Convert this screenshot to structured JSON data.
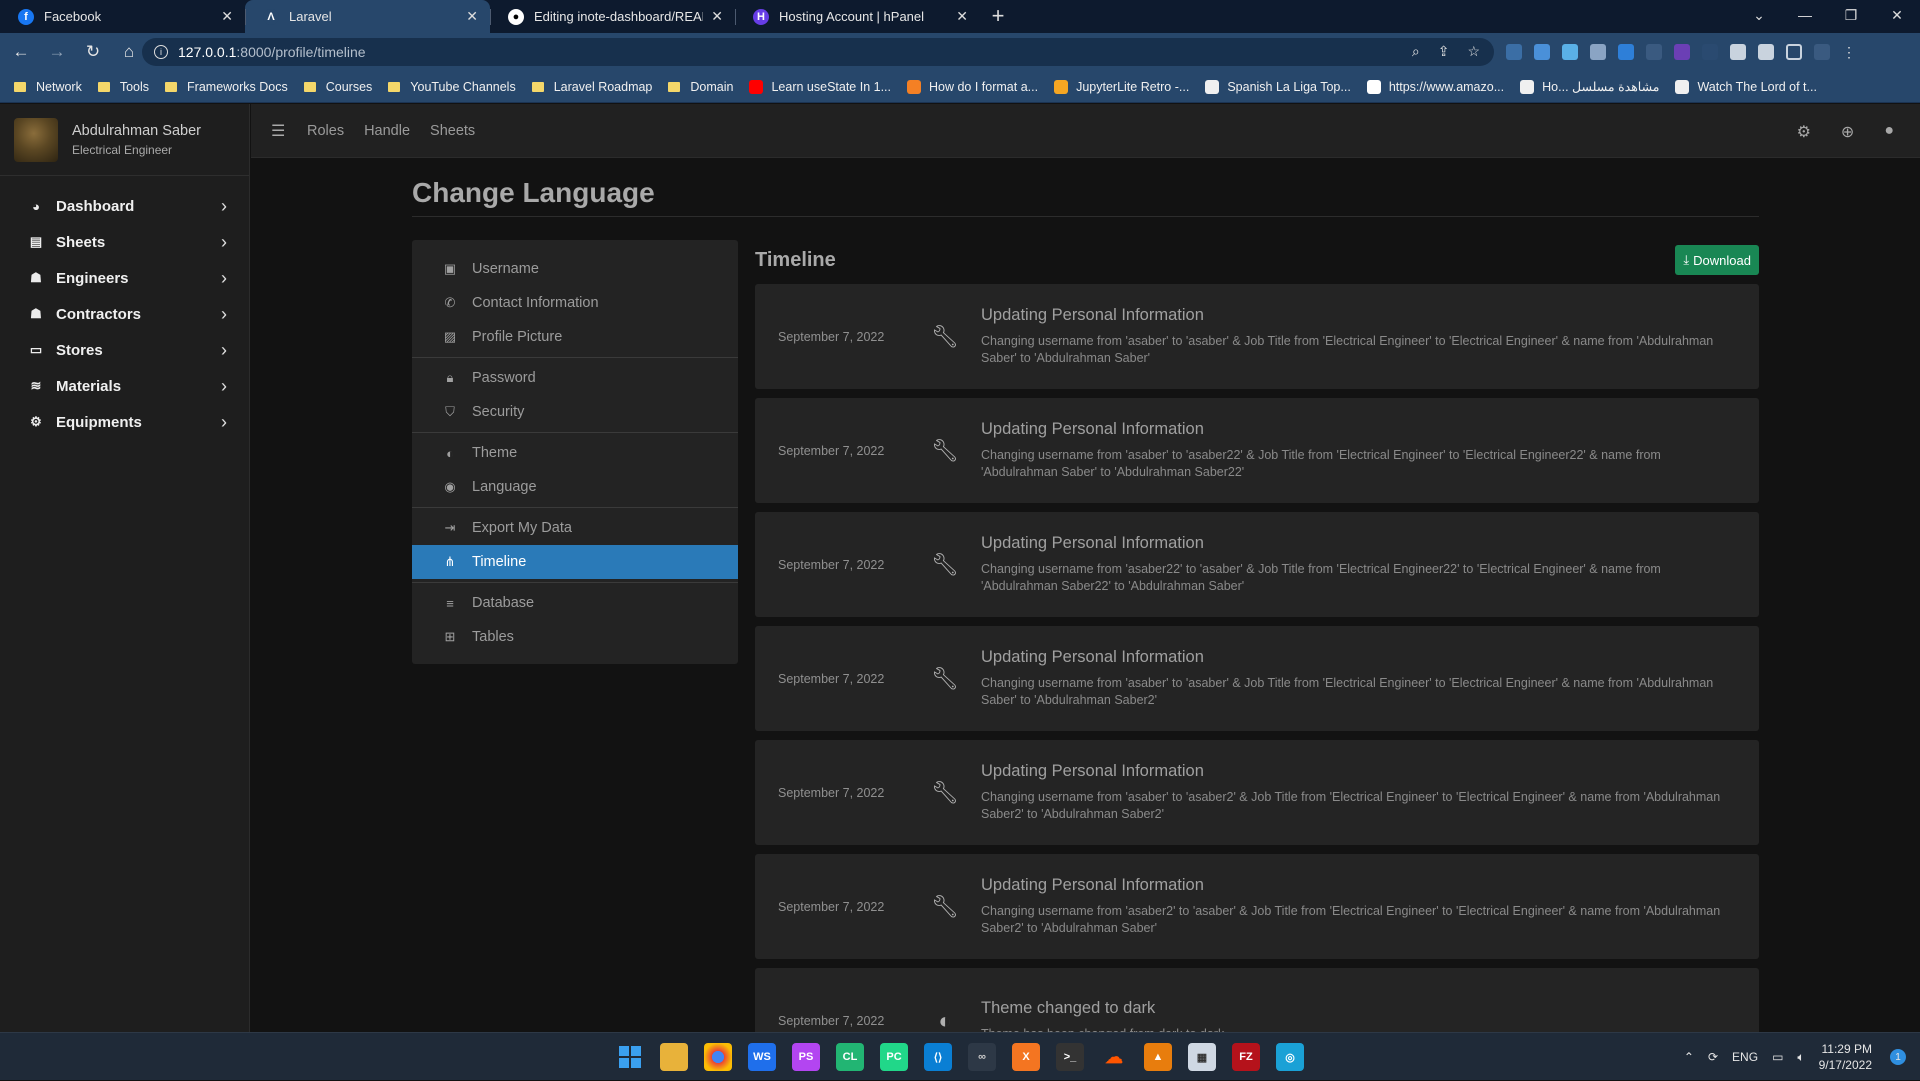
{
  "browser": {
    "tabs": [
      {
        "title": "Facebook",
        "favicon": "facebook-icon",
        "color": "#1877f2",
        "active": false
      },
      {
        "title": "Laravel",
        "favicon": "laravel-icon",
        "color": "#27476b",
        "active": true
      },
      {
        "title": "Editing inote-dashboard/README",
        "favicon": "github-icon",
        "color": "#ffffff",
        "active": false
      },
      {
        "title": "Hosting Account | hPanel",
        "favicon": "hostinger-icon",
        "color": "#673de6",
        "active": false
      }
    ],
    "url_host": "127.0.0.1",
    "url_path": ":8000/profile/timeline",
    "bookmarks": [
      {
        "label": "Network",
        "type": "folder"
      },
      {
        "label": "Tools",
        "type": "folder"
      },
      {
        "label": "Frameworks Docs",
        "type": "folder"
      },
      {
        "label": "Courses",
        "type": "folder"
      },
      {
        "label": "YouTube Channels",
        "type": "folder"
      },
      {
        "label": "Laravel Roadmap",
        "type": "folder"
      },
      {
        "label": "Domain",
        "type": "folder"
      },
      {
        "label": "Learn useState In 1...",
        "type": "youtube"
      },
      {
        "label": "How do I format a...",
        "type": "stackoverflow"
      },
      {
        "label": "JupyterLite Retro -...",
        "type": "jupyter"
      },
      {
        "label": "Spanish La Liga Top...",
        "type": "site"
      },
      {
        "label": "https://www.amazo...",
        "type": "amazon"
      },
      {
        "label": "Ho... مشاهدة مسلسل",
        "type": "site"
      },
      {
        "label": "Watch The Lord of t...",
        "type": "site"
      }
    ]
  },
  "sidebar": {
    "user_name": "Abdulrahman Saber",
    "user_role": "Electrical Engineer",
    "items": [
      {
        "label": "Dashboard",
        "icon": "dashboard-icon"
      },
      {
        "label": "Sheets",
        "icon": "file-icon"
      },
      {
        "label": "Engineers",
        "icon": "hardhat-icon"
      },
      {
        "label": "Contractors",
        "icon": "hardhat-icon"
      },
      {
        "label": "Stores",
        "icon": "store-icon"
      },
      {
        "label": "Materials",
        "icon": "layers-icon"
      },
      {
        "label": "Equipments",
        "icon": "equipment-icon"
      }
    ]
  },
  "topnav": {
    "links": [
      "Roles",
      "Handle",
      "Sheets"
    ]
  },
  "page": {
    "title": "Change Language"
  },
  "settings_menu": {
    "groups": [
      [
        {
          "label": "Username",
          "icon": "id-card-icon"
        },
        {
          "label": "Contact Information",
          "icon": "phone-icon"
        },
        {
          "label": "Profile Picture",
          "icon": "image-icon"
        }
      ],
      [
        {
          "label": "Password",
          "icon": "lock-icon"
        },
        {
          "label": "Security",
          "icon": "shield-icon"
        }
      ],
      [
        {
          "label": "Theme",
          "icon": "palette-icon"
        },
        {
          "label": "Language",
          "icon": "globe-icon"
        }
      ],
      [
        {
          "label": "Export My Data",
          "icon": "export-icon"
        },
        {
          "label": "Timeline",
          "icon": "timeline-icon",
          "active": true
        }
      ],
      [
        {
          "label": "Database",
          "icon": "database-icon"
        },
        {
          "label": "Tables",
          "icon": "table-icon"
        }
      ]
    ]
  },
  "timeline": {
    "title": "Timeline",
    "download_label": "Download",
    "entries": [
      {
        "date": "September 7, 2022",
        "icon": "wrench-icon",
        "title": "Updating Personal Information",
        "desc": "Changing username from 'asaber' to 'asaber' & Job Title from 'Electrical Engineer' to 'Electrical Engineer' & name from 'Abdulrahman Saber' to 'Abdulrahman Saber'"
      },
      {
        "date": "September 7, 2022",
        "icon": "wrench-icon",
        "title": "Updating Personal Information",
        "desc": "Changing username from 'asaber' to 'asaber22' & Job Title from 'Electrical Engineer' to 'Electrical Engineer22' & name from 'Abdulrahman Saber' to 'Abdulrahman Saber22'"
      },
      {
        "date": "September 7, 2022",
        "icon": "wrench-icon",
        "title": "Updating Personal Information",
        "desc": "Changing username from 'asaber22' to 'asaber' & Job Title from 'Electrical Engineer22' to 'Electrical Engineer' & name from 'Abdulrahman Saber22' to 'Abdulrahman Saber'"
      },
      {
        "date": "September 7, 2022",
        "icon": "wrench-icon",
        "title": "Updating Personal Information",
        "desc": "Changing username from 'asaber' to 'asaber' & Job Title from 'Electrical Engineer' to 'Electrical Engineer' & name from 'Abdulrahman Saber' to 'Abdulrahman Saber2'"
      },
      {
        "date": "September 7, 2022",
        "icon": "wrench-icon",
        "title": "Updating Personal Information",
        "desc": "Changing username from 'asaber' to 'asaber2' & Job Title from 'Electrical Engineer' to 'Electrical Engineer' & name from 'Abdulrahman Saber2' to 'Abdulrahman Saber2'"
      },
      {
        "date": "September 7, 2022",
        "icon": "wrench-icon",
        "title": "Updating Personal Information",
        "desc": "Changing username from 'asaber2' to 'asaber' & Job Title from 'Electrical Engineer' to 'Electrical Engineer' & name from 'Abdulrahman Saber2' to 'Abdulrahman Saber'"
      },
      {
        "date": "September 7, 2022",
        "icon": "palette-icon",
        "title": "Theme changed to dark",
        "desc": "Theme has been changed from dark to dark"
      }
    ]
  },
  "taskbar": {
    "language": "ENG",
    "time": "11:29 PM",
    "date": "9/17/2022",
    "notifications": "1"
  }
}
